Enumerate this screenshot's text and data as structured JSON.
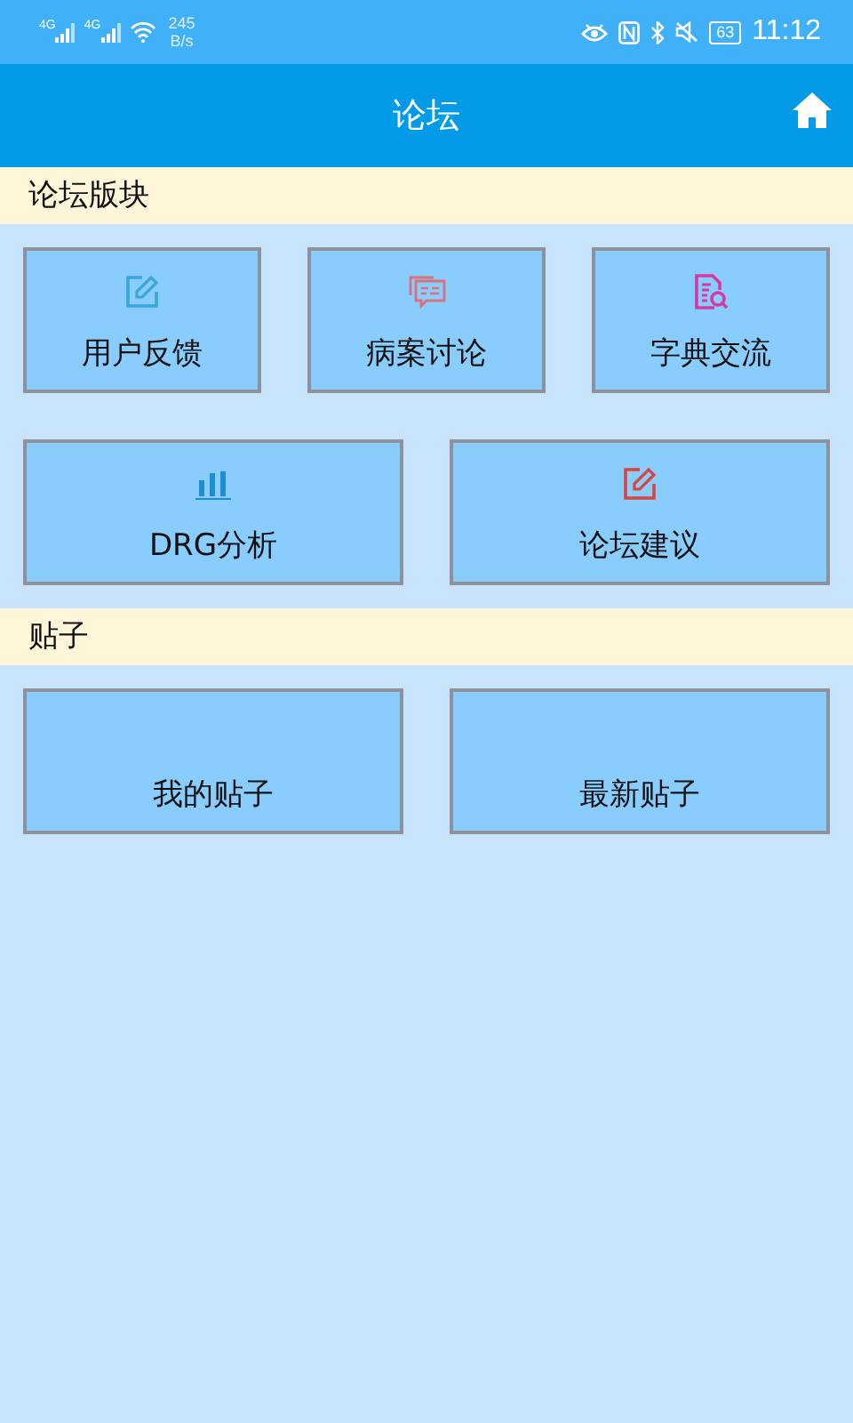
{
  "status_bar": {
    "network_1": "4G",
    "network_2": "4G",
    "speed_value": "245",
    "speed_unit": "B/s",
    "battery": "63",
    "time": "11:12"
  },
  "app_bar": {
    "title": "论坛"
  },
  "sections": [
    {
      "title": "论坛版块",
      "rows": [
        [
          {
            "label": "用户反馈",
            "kind": "edit",
            "color": "#3aa6dc"
          },
          {
            "label": "病案讨论",
            "kind": "chat",
            "color": "#d9707a"
          },
          {
            "label": "字典交流",
            "kind": "doc-search",
            "color": "#d63aa0"
          }
        ],
        [
          {
            "label": "DRG分析",
            "kind": "bars",
            "color": "#1b8fd2"
          },
          {
            "label": "论坛建议",
            "kind": "edit",
            "color": "#d9443f"
          }
        ]
      ]
    },
    {
      "title": "贴子",
      "rows": [
        [
          {
            "label": "我的贴子"
          },
          {
            "label": "最新贴子"
          }
        ]
      ]
    }
  ]
}
